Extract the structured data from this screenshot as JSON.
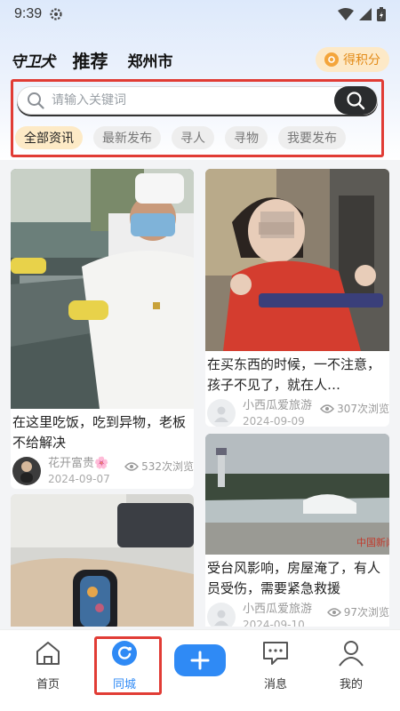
{
  "status": {
    "time": "9:39"
  },
  "header": {
    "logo": "守卫犬",
    "tab_recommend": "推荐",
    "tab_city": "郑州市",
    "points_label": "得积分"
  },
  "search": {
    "placeholder": "请输入关键词"
  },
  "chips": [
    "全部资讯",
    "最新发布",
    "寻人",
    "寻物",
    "我要发布"
  ],
  "cards": [
    {
      "title": "在这里吃饭，吃到异物，老板不给解决",
      "author": "花开富贵🌸",
      "date": "2024-09-07",
      "views": "532次浏览"
    },
    {
      "title": "在买东西的时候，一不注意，孩子不见了，就在人…",
      "author": "小西瓜爱旅游",
      "date": "2024-09-09",
      "views": "307次浏览"
    },
    {
      "title": "受台风影响，房屋淹了，有人员受伤，需要紧急救援",
      "author": "小西瓜爱旅游",
      "date": "2024-09-10",
      "views": "97次浏览"
    }
  ],
  "image_watermark": "中国新闻",
  "nav": {
    "home": "首页",
    "city": "同城",
    "messages": "消息",
    "mine": "我的"
  },
  "colors": {
    "accent": "#2f8af5",
    "highlight": "#e13c35",
    "points": "#e38b18"
  }
}
